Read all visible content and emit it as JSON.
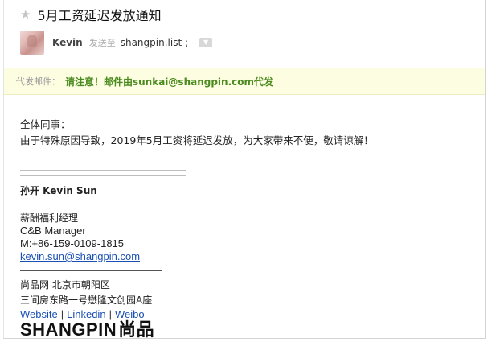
{
  "email": {
    "subject": "5月工资延迟发放通知",
    "sender_name": "Kevin",
    "send_to_label": "发送至",
    "recipient": "shangpin.list ;",
    "proxy_label": "代发邮件：",
    "proxy_text": "请注意！邮件由sunkai@shangpin.com代发",
    "greeting": "全体同事：",
    "message": "由于特殊原因导致，2019年5月工资将延迟发放，为大家带来不便，敬请谅解！"
  },
  "signature": {
    "name": "孙开 Kevin Sun",
    "title_cn": "薪酬福利经理",
    "title_en": "C&B Manager",
    "phone": "M:+86-159-0109-1815",
    "email": "kevin.sun@shangpin.com",
    "company": "尚品网 北京市朝阳区",
    "address": "三间房东路一号懋隆文创园A座",
    "links": [
      "Website",
      "Linkedin",
      "Weibo"
    ],
    "separator": "|",
    "brand_en": "SHANGPIN",
    "brand_cn": "尚品"
  },
  "icons": {
    "star": "star-icon",
    "avatar": "avatar-image",
    "dropdown": "chevron-down-icon"
  },
  "colors": {
    "proxy_bar_bg": "#fdfde1",
    "proxy_text": "#4a8a1e",
    "link": "#1a4fb4"
  }
}
